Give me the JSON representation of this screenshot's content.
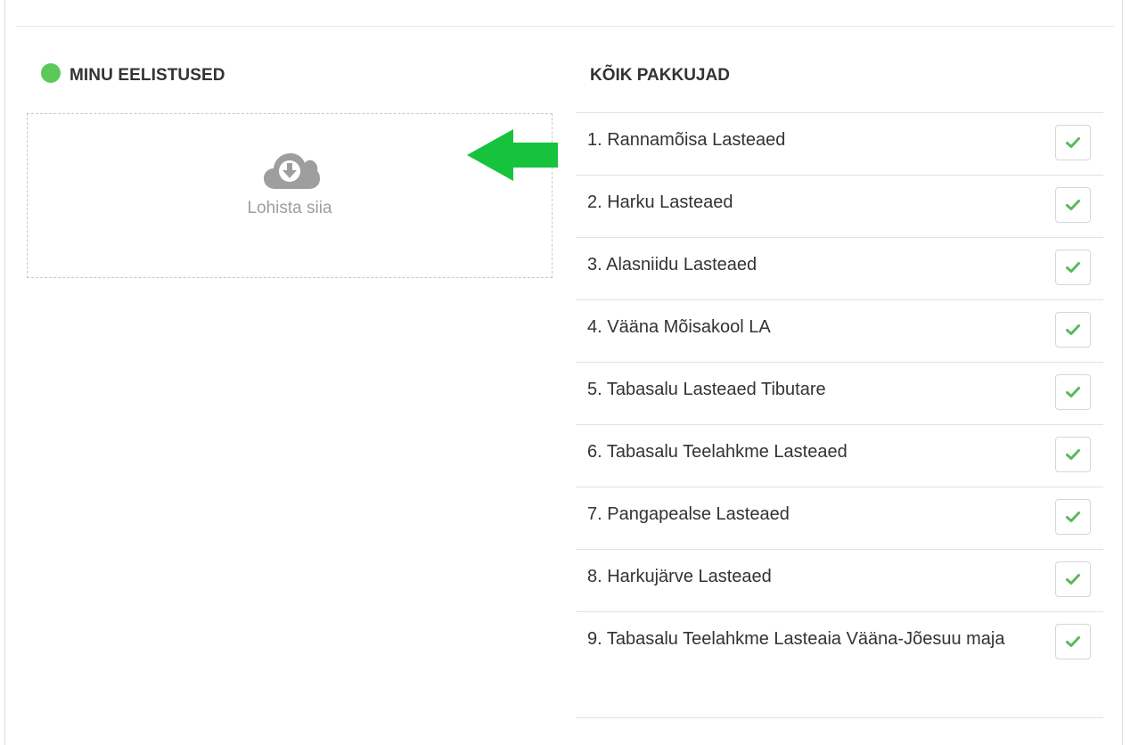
{
  "preferences": {
    "title": "MINU EELISTUSED",
    "status_color": "#5cc85c",
    "dropzone": {
      "label": "Lohista siia",
      "icon": "cloud-download-icon"
    },
    "drag_hint_icon": "arrow-left-icon",
    "drag_hint_color": "#17c23c"
  },
  "providers": {
    "title": "KÕIK PAKKUJAD",
    "select_icon": "check-icon",
    "check_color": "#5cb85c",
    "items": [
      {
        "label": "1. Rannamõisa Lasteaed"
      },
      {
        "label": "2. Harku Lasteaed"
      },
      {
        "label": "3. Alasniidu Lasteaed"
      },
      {
        "label": "4. Vääna Mõisakool LA"
      },
      {
        "label": "5. Tabasalu Lasteaed Tibutare"
      },
      {
        "label": "6. Tabasalu Teelahkme Lasteaed"
      },
      {
        "label": "7. Pangapealse Lasteaed"
      },
      {
        "label": "8. Harkujärve Lasteaed"
      },
      {
        "label": "9. Tabasalu Teelahkme Lasteaia Vääna-Jõesuu maja"
      }
    ]
  }
}
